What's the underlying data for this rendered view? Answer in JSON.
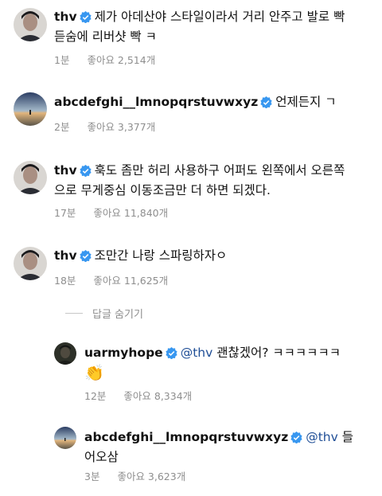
{
  "comments": [
    {
      "username": "thv",
      "text_line1": "제가 아데산야 스타일이라서 거리 안주고 발로 빡",
      "text_line2": "듣숨에 리버샷 빡 ㅋ",
      "time": "1분",
      "likes": "좋아요 2,514개"
    },
    {
      "username": "abcdefghi__lmnopqrstuvwxyz",
      "text_line1": "언제든지 ㄱ",
      "time": "2분",
      "likes": "좋아요 3,377개"
    },
    {
      "username": "thv",
      "text_line1": "훅도 좀만 허리 사용하구 어퍼도 왼쪽에서 오른쪽",
      "text_line2": "으로 무게중심 이동조금만 더 하면 되겠다.",
      "time": "17분",
      "likes": "좋아요 11,840개"
    },
    {
      "username": "thv",
      "text_line1": "조만간 나랑 스파링하자ㅇ",
      "time": "18분",
      "likes": "좋아요 11,625개"
    }
  ],
  "hide_replies_label": "답글 숨기기",
  "replies": [
    {
      "username": "uarmyhope",
      "mention": "@thv",
      "text_line1": "괜찮겠어? ㅋㅋㅋㅋㅋㅋ",
      "emoji": "👏",
      "time": "12분",
      "likes": "좋아요 8,334개"
    },
    {
      "username": "abcdefghi__lmnopqrstuvwxyz",
      "mention": "@thv",
      "text_line1": "들",
      "text_line2": "어오삼",
      "time": "3분",
      "likes": "좋아요 3,623개"
    }
  ],
  "colors": {
    "verified": "#3897f0",
    "mention": "#1f4e96",
    "meta": "#8e8e8e"
  }
}
